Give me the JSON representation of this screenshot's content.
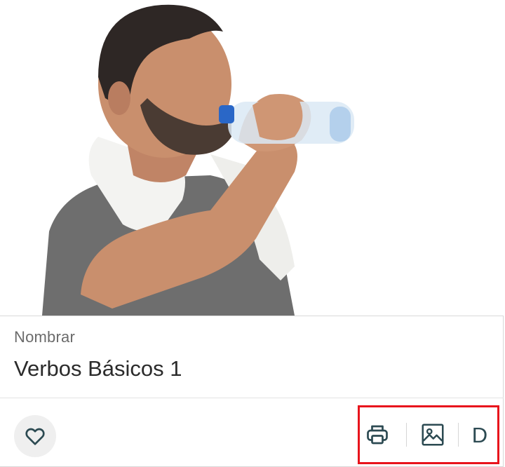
{
  "card": {
    "image_alt": "man drinking from a water bottle",
    "category": "Nombrar",
    "title": "Verbos Básicos 1"
  },
  "actions": {
    "favorite_icon": "heart-icon",
    "print_icon": "printer-icon",
    "image_icon": "image-icon",
    "letter_label": "D"
  },
  "colors": {
    "icon": "#2c4a52",
    "highlight_border": "#e8141c",
    "fav_bg": "#efefef"
  }
}
